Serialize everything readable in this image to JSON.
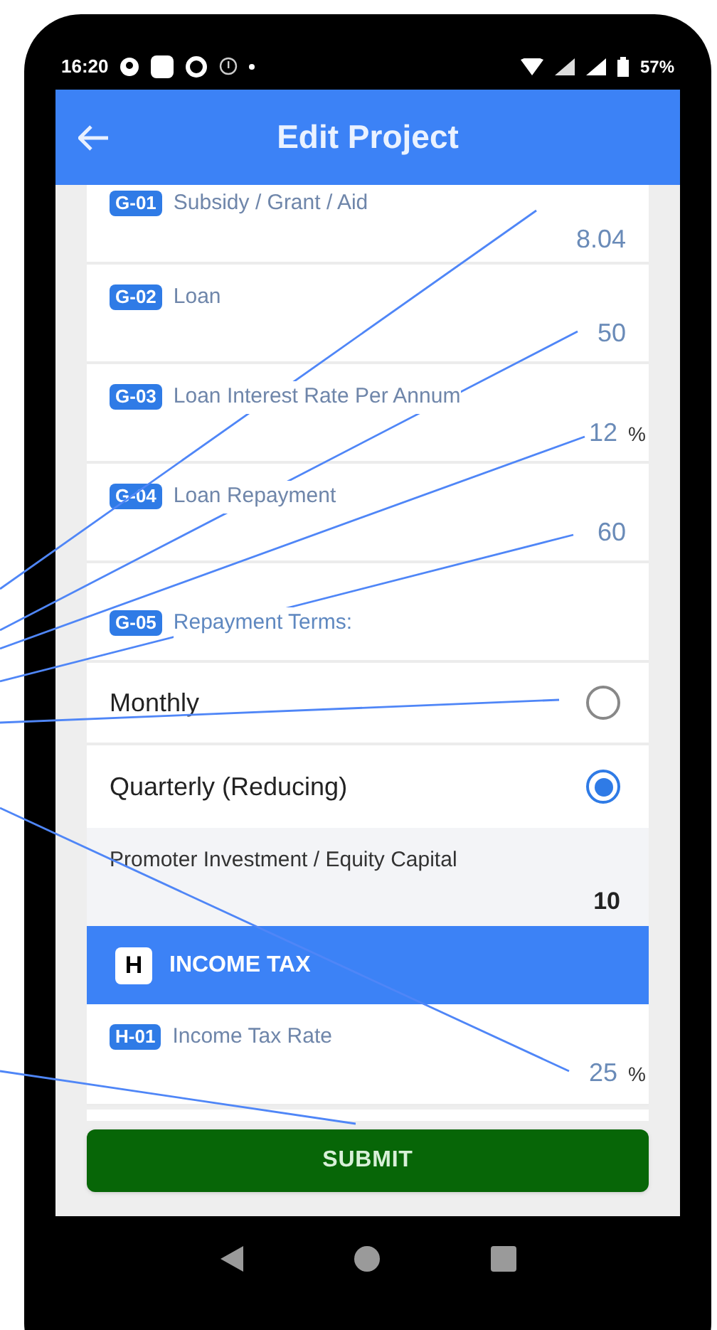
{
  "status_bar": {
    "time": "16:20",
    "battery": "57%"
  },
  "app_bar": {
    "title": "Edit Project"
  },
  "fields": [
    {
      "badge": "G-01",
      "label": "Subsidy / Grant / Aid",
      "value": "8.04"
    },
    {
      "badge": "G-02",
      "label": "Loan",
      "value": "50"
    },
    {
      "badge": "G-03",
      "label": "Loan Interest Rate Per Annum",
      "value": "12",
      "unit": "%"
    },
    {
      "badge": "G-04",
      "label": "Loan Repayment",
      "value": "60"
    }
  ],
  "repayment_terms": {
    "badge": "G-05",
    "label": "Repayment Terms:",
    "options": [
      {
        "label": "Monthly",
        "selected": false
      },
      {
        "label": "Quarterly (Reducing)",
        "selected": true
      }
    ]
  },
  "promoter": {
    "label": "Promoter Investment / Equity Capital",
    "value": "10"
  },
  "section": {
    "letter": "H",
    "title": "INCOME TAX"
  },
  "tax_fields": [
    {
      "badge": "H-01",
      "label": "Income Tax Rate",
      "value": "25",
      "unit": "%"
    }
  ],
  "submit": "SUBMIT"
}
